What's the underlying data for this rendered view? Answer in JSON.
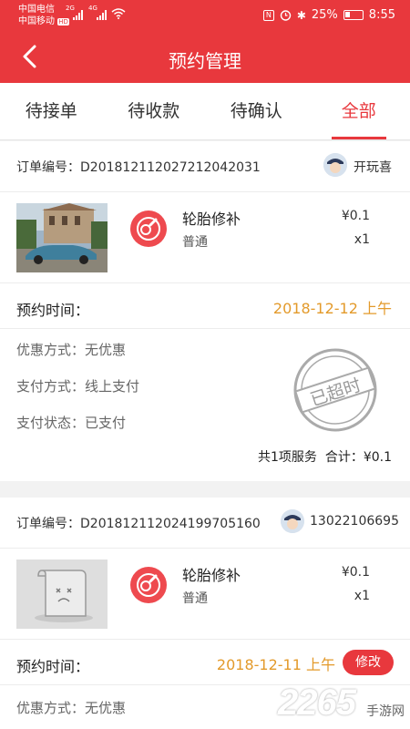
{
  "status": {
    "carrier1": "中国电信",
    "carrier2": "中国移动",
    "hd": "HD",
    "net1": "2G",
    "net2": "4G",
    "battery": "25%",
    "time": "8:55"
  },
  "header": {
    "title": "预约管理"
  },
  "tabs": [
    {
      "label": "待接单"
    },
    {
      "label": "待收款"
    },
    {
      "label": "待确认"
    },
    {
      "label": "全部",
      "active": true
    }
  ],
  "orders": [
    {
      "order_label": "订单编号：",
      "order_no": "D201812112027212042031",
      "user": "开玩喜",
      "service_name": "轮胎修补",
      "service_type": "普通",
      "price": "¥0.1",
      "qty": "x1",
      "time_label": "预约时间：",
      "time_value": "2018-12-12 上午",
      "discount": "优惠方式：无优惠",
      "pay_method": "支付方式：线上支付",
      "pay_status": "支付状态：已支付",
      "stamp": "已超时",
      "summary": "共1项服务  合计：¥0.1"
    },
    {
      "order_label": "订单编号：",
      "order_no": "D201812112024199705160",
      "user": "13022106695",
      "service_name": "轮胎修补",
      "service_type": "普通",
      "price": "¥0.1",
      "qty": "x1",
      "time_label": "预约时间：",
      "time_value": "2018-12-11 上午",
      "modify_label": "修改",
      "discount": "优惠方式：无优惠"
    }
  ],
  "watermark": {
    "brand": "2265",
    "sub": "手游网"
  },
  "colors": {
    "accent": "#e8383d",
    "time": "#e39a2b"
  }
}
